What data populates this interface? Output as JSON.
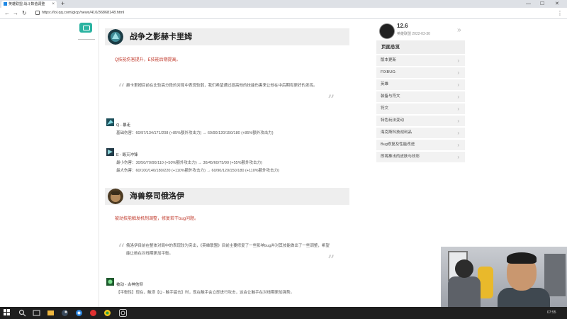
{
  "browser": {
    "tab_title": "英雄联盟 战斗数值调整",
    "url": "https://lol.qq.com/gicp/news/410/36868148.html",
    "new_tab": "+",
    "minimize": "—",
    "maximize": "☐",
    "close": "✕"
  },
  "article": {
    "heroes": [
      {
        "name": "战争之影赫卡里姆",
        "note": "Q技能伤害提升，E技能后期提高。",
        "quote": "赫卡里姆目前在比较高分段的对局中表现较弱，我们希望通过提高他的技能伤害来让他在中后期有更好的发挥。",
        "abilities": [
          {
            "name": "Q - 暴走",
            "lines": [
              "基础伤害：60/97/134/171/208 (+85%额外攻击力) → 60/90/120/150/180 (+85%额外攻击力)"
            ]
          },
          {
            "name": "E - 毁灭冲锋",
            "lines": [
              "最小伤害：30/50/70/90/110 (+50%额外攻击力) → 30/45/60/75/90 (+55%额外攻击力)",
              "最大伤害：60/100/140/180/220 (+110%额外攻击力) → 60/90/120/150/180 (+110%额外攻击力)"
            ]
          }
        ]
      },
      {
        "name": "海兽祭司俄洛伊",
        "note": "被动技能触发机制调整，修复若干bug问题。",
        "quote": "俄洛伊目前在整体对局中的表现较为突出，《英雄联盟》目前主要修复了一些影响bug并对其技能做出了一些调整，希望能让她在对线期更加平衡。",
        "abilities": [
          {
            "name": "被动 - 古神信仰",
            "lines": [
              "【平衡性】现在，触须【Q - 触手猛击】时，现在触手会立即进行攻击，这会让触手在对线期更加强势。"
            ]
          }
        ]
      }
    ]
  },
  "author": {
    "name": "12.6",
    "meta": "英雄联盟   2022-03-30"
  },
  "toc": {
    "title": "页面总览",
    "items": [
      "版本更新",
      "FIXBUG:",
      "英雄",
      "装备与符文",
      "符文",
      "特色玩法变动",
      "海克斯科技战利品",
      "Bug修复及性能改进",
      "即将推出的皮肤与炫彩"
    ]
  },
  "colors": {
    "accent_teal": "#2bb3a1",
    "note_red": "#c0392b",
    "taskbar": "#1f1f1f"
  },
  "taskbar": {
    "icons": [
      "windows-icon",
      "search-icon",
      "file-explorer-icon",
      "media-icon",
      "steam-icon",
      "browser-icon",
      "netease-icon",
      "game-icon",
      "app-icon"
    ],
    "tray": "07:55"
  }
}
